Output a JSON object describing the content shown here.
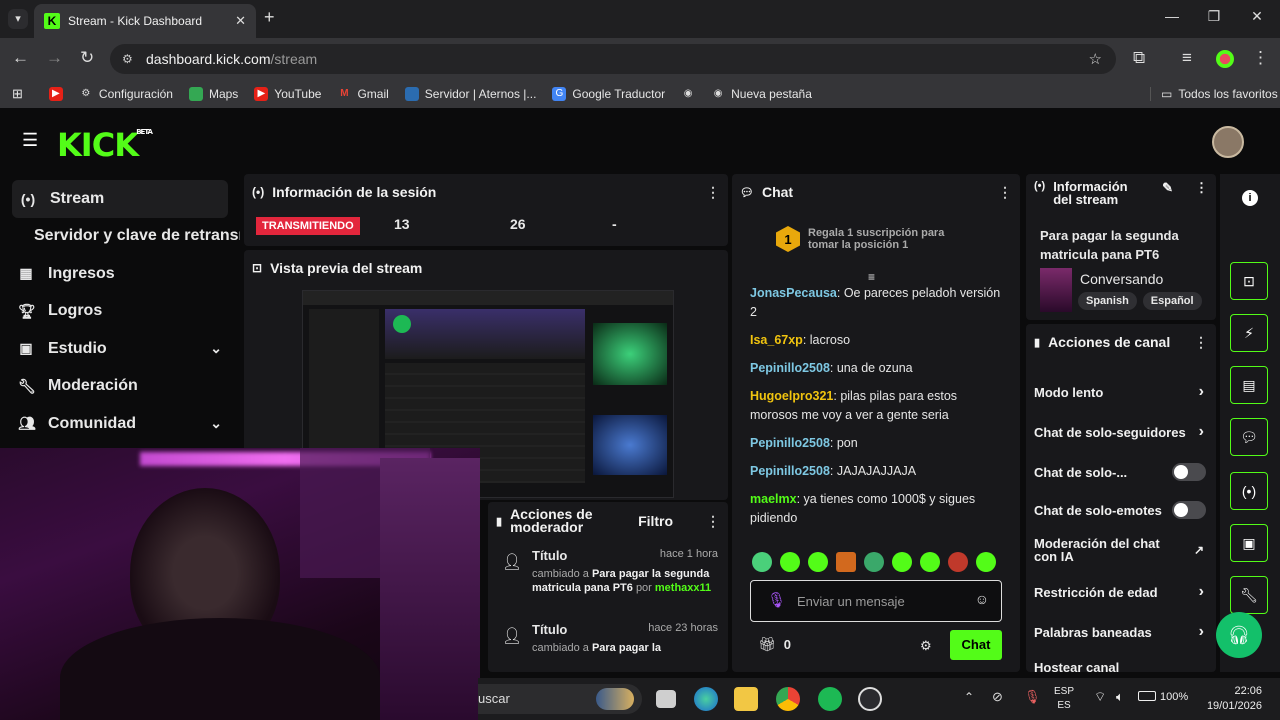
{
  "browser": {
    "tab_title": "Stream - Kick Dashboard",
    "url_host": "dashboard.kick.com",
    "url_path": "/stream",
    "bookmarks": [
      "Configuración",
      "Maps",
      "YouTube",
      "Gmail",
      "Servidor | Aternos |...",
      "Google Traductor",
      "Nueva pestaña"
    ],
    "all_favorites": "Todos los favoritos"
  },
  "kick": {
    "logo": "KICK",
    "logo_sup": "BETA",
    "sidebar": [
      {
        "label": "Stream",
        "icon": "broadcast-icon"
      },
      {
        "label": "Servidor y clave de retransm",
        "icon": ""
      },
      {
        "label": "Ingresos",
        "icon": "chart-icon"
      },
      {
        "label": "Logros",
        "icon": "trophy-icon"
      },
      {
        "label": "Estudio",
        "icon": "studio-icon"
      },
      {
        "label": "Moderación",
        "icon": "wrench-icon"
      },
      {
        "label": "Comunidad",
        "icon": "users-icon"
      }
    ],
    "session": {
      "title": "Información de la sesión",
      "status": "TRANSMITIENDO",
      "stat1": "13",
      "stat2": "26",
      "stat3": "-"
    },
    "preview": {
      "title": "Vista previa del stream"
    },
    "mod_actions": {
      "title": "Acciones de moderador",
      "filter": "Filtro",
      "items": [
        {
          "title": "Título",
          "time": "hace 1 hora",
          "pre": "cambiado a",
          "value": "Para pagar la segunda matricula pana PT6",
          "by": "por",
          "user": "methaxx11"
        },
        {
          "title": "Título",
          "time": "hace 23 horas",
          "pre": "cambiado a",
          "value": "Para pagar la",
          "by": "",
          "user": ""
        }
      ]
    },
    "chat": {
      "title": "Chat",
      "gift_prompt": "Regala 1 suscripción para tomar la posición 1",
      "gift_rank": "1",
      "messages": [
        {
          "user": "JonasPecausa",
          "color": "#7ec8e3",
          "text": "Oe pareces peladoh versión 2"
        },
        {
          "user": "Isa_67xp",
          "color": "#f1c40f",
          "text": "lacroso"
        },
        {
          "user": "Pepinillo2508",
          "color": "#7ec8e3",
          "text": "una de ozuna"
        },
        {
          "user": "Hugoelpro321",
          "color": "#f1c40f",
          "text": "pilas pilas para estos morosos me voy a ver a gente seria"
        },
        {
          "user": "Pepinillo2508",
          "color": "#7ec8e3",
          "text": "pon"
        },
        {
          "user": "Pepinillo2508",
          "color": "#7ec8e3",
          "text": "JAJAJAJJAJA"
        },
        {
          "user": "maelmx",
          "color": "#53fc18",
          "text": "ya tienes como 1000$ y sigues pidiendo"
        }
      ],
      "input_placeholder": "Enviar un mensaje",
      "points": "0",
      "send_label": "Chat"
    },
    "stream_info": {
      "title": "Información del stream",
      "stream_title": "Para pagar la segunda matricula pana PT6",
      "category": "Conversando",
      "tags": [
        "Spanish",
        "Español"
      ]
    },
    "channel_actions": {
      "title": "Acciones de canal",
      "items": [
        {
          "label": "Modo lento",
          "kind": "arrow"
        },
        {
          "label": "Chat de solo-seguidores",
          "kind": "arrow"
        },
        {
          "label": "Chat de solo-...",
          "kind": "toggle"
        },
        {
          "label": "Chat de solo-emotes",
          "kind": "toggle"
        },
        {
          "label": "Moderación del chat con IA",
          "kind": "external"
        },
        {
          "label": "Restricción de edad",
          "kind": "arrow"
        },
        {
          "label": "Palabras baneadas",
          "kind": "arrow"
        },
        {
          "label": "Hostear canal",
          "kind": "none"
        }
      ]
    }
  },
  "taskbar": {
    "search": "uscar",
    "lang1": "ESP",
    "lang2": "ES",
    "battery": "100%",
    "time": "22:06",
    "date": "19/01/2026"
  }
}
